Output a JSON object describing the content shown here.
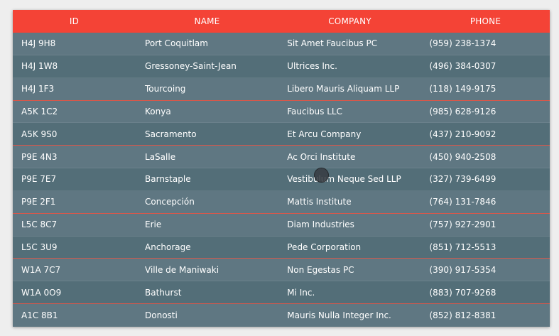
{
  "table": {
    "columns": [
      "ID",
      "NAME",
      "COMPANY",
      "PHONE"
    ],
    "rows": [
      {
        "id": "H4J 9H8",
        "name": "Port Coquitlam",
        "company": "Sit Amet Faucibus PC",
        "phone": "(959) 238-1374"
      },
      {
        "id": "H4J 1W8",
        "name": "Gressoney-Saint-Jean",
        "company": "Ultrices Inc.",
        "phone": "(496) 384-0307"
      },
      {
        "id": "H4J 1F3",
        "name": "Tourcoing",
        "company": "Libero Mauris Aliquam LLP",
        "phone": "(118) 149-9175"
      },
      {
        "id": "A5K 1C2",
        "name": "Konya",
        "company": "Faucibus LLC",
        "phone": "(985) 628-9126"
      },
      {
        "id": "A5K 9S0",
        "name": "Sacramento",
        "company": "Et Arcu Company",
        "phone": "(437) 210-9092"
      },
      {
        "id": "P9E 4N3",
        "name": "LaSalle",
        "company": "Ac Orci Institute",
        "phone": "(450) 940-2508"
      },
      {
        "id": "P9E 7E7",
        "name": "Barnstaple",
        "company": "Vestibulum Neque Sed LLP",
        "phone": "(327) 739-6499"
      },
      {
        "id": "P9E 2F1",
        "name": "Concepción",
        "company": "Mattis Institute",
        "phone": "(764) 131-7846"
      },
      {
        "id": "L5C 8C7",
        "name": "Erie",
        "company": "Diam Industries",
        "phone": "(757) 927-2901"
      },
      {
        "id": "L5C 3U9",
        "name": "Anchorage",
        "company": "Pede Corporation",
        "phone": "(851) 712-5513"
      },
      {
        "id": "W1A 7C7",
        "name": "Ville de Maniwaki",
        "company": "Non Egestas PC",
        "phone": "(390) 917-5354"
      },
      {
        "id": "W1A 0O9",
        "name": "Bathurst",
        "company": "Mi Inc.",
        "phone": "(883) 707-9268"
      },
      {
        "id": "A1C 8B1",
        "name": "Donosti",
        "company": "Mauris Nulla Integer Inc.",
        "phone": "(852) 812-8381"
      }
    ]
  },
  "colors": {
    "header_bg": "#f44336",
    "row_bg": "#5f7782",
    "row_alt_bg": "#536e78",
    "group_divider": "#d9574a"
  },
  "cursor_icon": "mouse-cursor-icon"
}
